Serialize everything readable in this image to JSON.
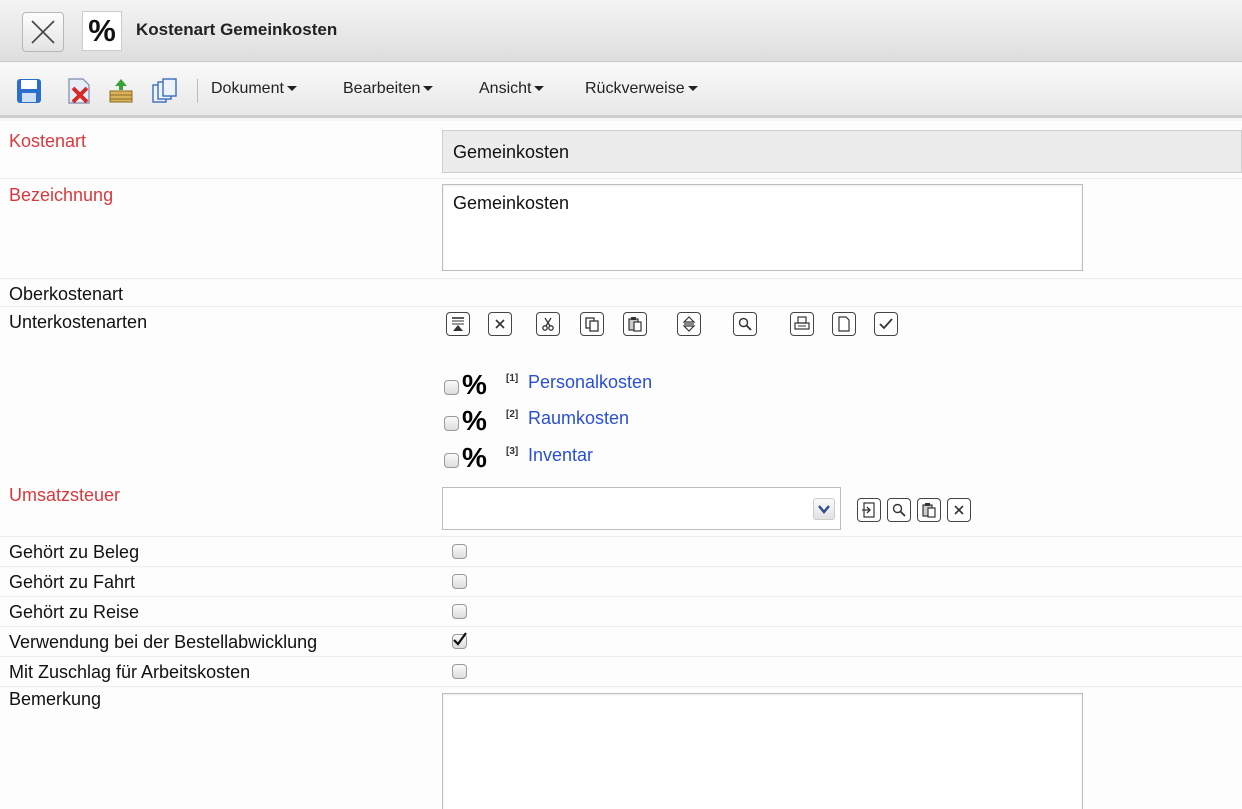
{
  "window": {
    "title": "Kostenart Gemeinkosten",
    "close_icon": "close-x-icon",
    "type_symbol": "%"
  },
  "toolbar": {
    "icons": [
      "save-icon",
      "delete-document-icon",
      "export-basket-icon",
      "copy-pages-icon"
    ],
    "menus": [
      "Dokument",
      "Bearbeiten",
      "Ansicht",
      "Rückverweise"
    ]
  },
  "form": {
    "kostenart": {
      "label": "Kostenart",
      "value": "Gemeinkosten"
    },
    "bezeichnung": {
      "label": "Bezeichnung",
      "value": "Gemeinkosten"
    },
    "oberkostenart": {
      "label": "Oberkostenart"
    },
    "unterkostenarten": {
      "label": "Unterkostenarten",
      "tool_icons": [
        "move-top-icon",
        "remove-icon",
        "cut-icon",
        "copy-icon",
        "paste-icon",
        "sort-updown-icon",
        "search-icon",
        "print-icon",
        "new-document-icon",
        "check-icon"
      ],
      "items": [
        {
          "ref": "[1]",
          "symbol": "%",
          "label": "Personalkosten"
        },
        {
          "ref": "[2]",
          "symbol": "%",
          "label": "Raumkosten"
        },
        {
          "ref": "[3]",
          "symbol": "%",
          "label": "Inventar"
        }
      ]
    },
    "umsatzsteuer": {
      "label": "Umsatzsteuer",
      "value": "",
      "tool_icons": [
        "open-link-icon",
        "search-icon",
        "paste-icon",
        "remove-icon"
      ]
    },
    "checkboxes": [
      {
        "label": "Gehört zu Beleg",
        "checked": false
      },
      {
        "label": "Gehört zu Fahrt",
        "checked": false
      },
      {
        "label": "Gehört zu Reise",
        "checked": false
      },
      {
        "label": "Verwendung bei der Bestellabwicklung",
        "checked": true
      },
      {
        "label": "Mit Zuschlag für Arbeitskosten",
        "checked": false
      }
    ],
    "bemerkung": {
      "label": "Bemerkung",
      "value": ""
    }
  },
  "colors": {
    "required_label": "#d9393d",
    "link": "#2a4fd6"
  }
}
